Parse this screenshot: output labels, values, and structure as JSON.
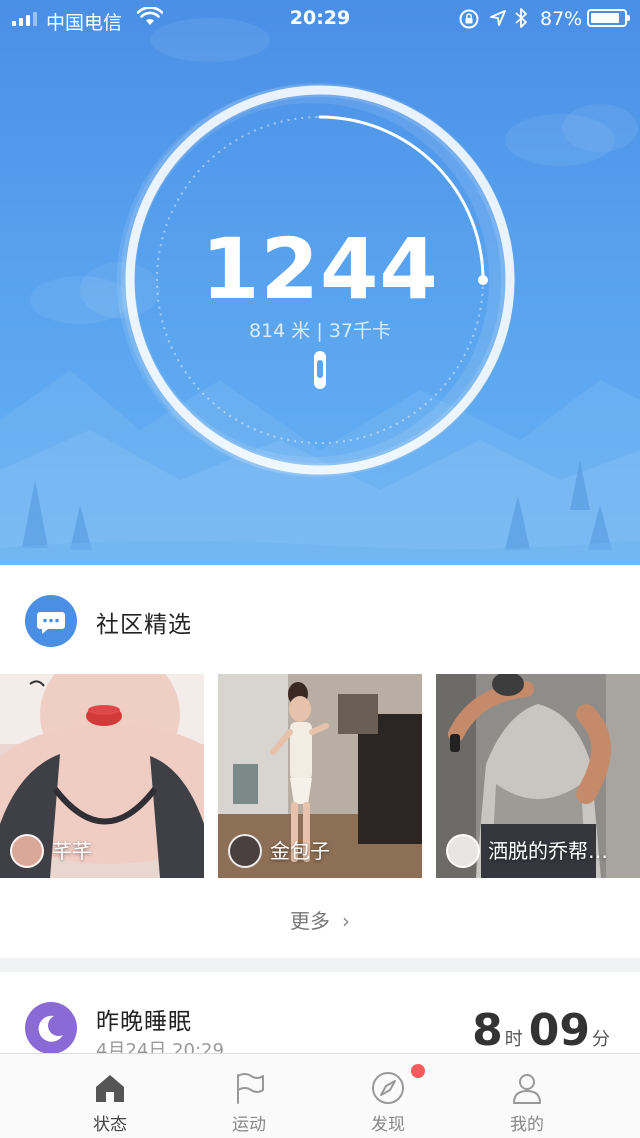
{
  "status_bar": {
    "carrier": "中国电信",
    "time": "20:29",
    "battery_percent": "87%",
    "battery_level": 0.87,
    "icons": [
      "signal-icon",
      "wifi-icon",
      "rotation-lock-icon",
      "location-icon",
      "bluetooth-icon",
      "battery-icon"
    ]
  },
  "activity": {
    "steps": "1244",
    "distance": "814 米",
    "separator": "|",
    "calories": "37千卡",
    "goal_progress": 0.25,
    "device_icon": "band-icon"
  },
  "community": {
    "title": "社区精选",
    "icon": "chat-bubble-icon",
    "posts": [
      {
        "user": "芊芊"
      },
      {
        "user": "金包子"
      },
      {
        "user": "洒脱的乔帮…"
      }
    ],
    "more_label": "更多",
    "more_icon": "chevron-right-icon"
  },
  "sleep": {
    "title": "昨晚睡眠",
    "icon": "moon-icon",
    "date": "4月24日 20:29",
    "hours": "8",
    "hours_unit": "时",
    "minutes": "09",
    "minutes_unit": "分"
  },
  "tabbar": {
    "tabs": [
      {
        "label": "状态",
        "icon": "home-icon",
        "active": true
      },
      {
        "label": "运动",
        "icon": "flag-icon",
        "active": false
      },
      {
        "label": "发现",
        "icon": "compass-icon",
        "active": false,
        "badge": true
      },
      {
        "label": "我的",
        "icon": "person-icon",
        "active": false
      }
    ]
  },
  "colors": {
    "hero_blue": "#4a8fe6",
    "community_badge": "#4a8fe3",
    "sleep_badge": "#8a6bd6",
    "notification_dot": "#f25b5b"
  }
}
